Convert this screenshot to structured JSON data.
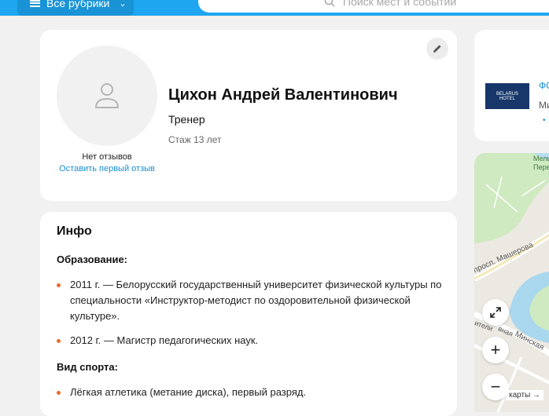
{
  "header": {
    "rubrics_label": "Все рубрики",
    "search_placeholder": "Поиск мест и событий"
  },
  "profile": {
    "no_reviews": "Нет отзывов",
    "leave_review": "Оставить первый отзыв",
    "name": "Цихон Андрей Валентинович",
    "role": "Тренер",
    "experience": "Стаж 13 лет"
  },
  "info": {
    "title": "Инфо",
    "education_label": "Образование:",
    "education": [
      "2011 г. — Белорусский государственный университет физической культуры по специальности «Инструктор-методист по оздоровительной физической культуре».",
      "2012 г. — Магистр педагогических наук."
    ],
    "sport_label": "Вид спорта:",
    "sport": [
      "Лёгкая атлетика (метание диска), первый разряд."
    ]
  },
  "side": {
    "logo_text": "BELARUS",
    "logo_subtext": "HOTEL",
    "link": "ФС",
    "sub": "Ми"
  },
  "map": {
    "labels": [
      "Мель",
      "Пере",
      "просп. Машерова",
      "Минская",
      "ители",
      "вная"
    ],
    "to_map": "карты →"
  },
  "colors": {
    "header": "#1ea6f0",
    "link": "#1a8fd1",
    "bullet": "#f06a28"
  }
}
